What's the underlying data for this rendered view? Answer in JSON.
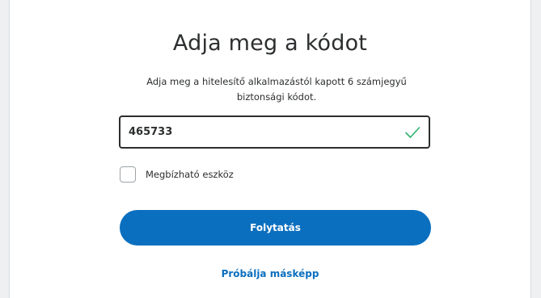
{
  "dialog": {
    "title": "Adja meg a kódot",
    "subtitle": "Adja meg a hitelesítő alkalmazástól kapott 6 számjegyű biztonsági kódot."
  },
  "code_input": {
    "value": "465733",
    "valid": true
  },
  "trusted_device": {
    "label": "Megbízható eszköz",
    "checked": false
  },
  "continue_button": {
    "label": "Folytatás"
  },
  "alt_link": {
    "label": "Próbálja másképp"
  },
  "colors": {
    "primary": "#0b6fbf",
    "success": "#2fb36b",
    "text": "#2c2e2f"
  }
}
